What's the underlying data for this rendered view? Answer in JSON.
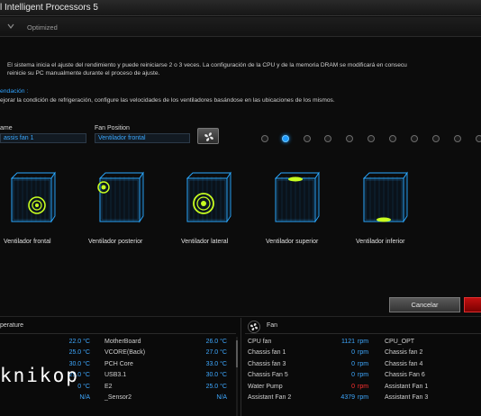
{
  "window": {
    "title": "l Intelligent Processors 5"
  },
  "subheader": {
    "mode": "Optimized"
  },
  "info": {
    "line1": "El sistema inicia el ajuste del rendimiento y puede reiniciarse 2 o 3 veces. La configuración de la CPU y de la memoria DRAM se modificará en consecu",
    "line2": "reinicie su PC manualmente durante el proceso de ajuste."
  },
  "recommendation": {
    "title": "endación :",
    "body": "ejorar la condición de refrigeración, configure las velocidades de los ventiladores basándose en las ubicaciones de los mismos."
  },
  "fan_config": {
    "name_label": "ame",
    "name_value": "assis fan 1",
    "position_label": "Fan Position",
    "position_value": "Ventilador frontal",
    "active_dot": 1
  },
  "positions": [
    {
      "label": "Ventilador frontal"
    },
    {
      "label": "Ventilador posterior"
    },
    {
      "label": "Ventilador lateral"
    },
    {
      "label": "Ventilador superior"
    },
    {
      "label": "Ventilador inferior"
    }
  ],
  "buttons": {
    "cancel": "Cancelar"
  },
  "temperature": {
    "header": "perature",
    "rows": [
      {
        "v1": "22.0 °C",
        "name": "MotherBoard",
        "v2": "26.0 °C"
      },
      {
        "v1": "25.0 °C",
        "name": "VCORE(Back)",
        "v2": "27.0 °C"
      },
      {
        "v1": "30.0 °C",
        "name": "PCH Core",
        "v2": "33.0 °C"
      },
      {
        "v1": "29.0 °C",
        "name": "USB3.1",
        "v2": "30.0 °C"
      },
      {
        "v1": "0 °C",
        "name": "E2",
        "v2": "25.0 °C"
      },
      {
        "v1": "N/A",
        "name": "_Sensor2",
        "v2": "N/A"
      }
    ]
  },
  "fan": {
    "header": "Fan",
    "rows": [
      {
        "name": "CPU fan",
        "value": "1121",
        "unit": "rpm",
        "right": "CPU_OPT",
        "alert": false
      },
      {
        "name": "Chassis fan 1",
        "value": "0",
        "unit": "rpm",
        "right": "Chassis fan 2",
        "alert": false
      },
      {
        "name": "Chassis fan 3",
        "value": "0",
        "unit": "rpm",
        "right": "Chassis fan 4",
        "alert": false
      },
      {
        "name": "Chassis Fan 5",
        "value": "0",
        "unit": "rpm",
        "right": "Chassis Fan 6",
        "alert": false
      },
      {
        "name": "Water Pump",
        "value": "0",
        "unit": "rpm",
        "right": "Assistant Fan 1",
        "alert": true
      },
      {
        "name": "Assistant Fan 2",
        "value": "4379",
        "unit": "rpm",
        "right": "Assistant Fan 3",
        "alert": false
      }
    ]
  },
  "watermark": "knikop",
  "colors": {
    "accent": "#1e9cff",
    "alert": "#ff3030",
    "fan_highlight": "#c8ff20",
    "case_wire": "#2aa8ff"
  }
}
